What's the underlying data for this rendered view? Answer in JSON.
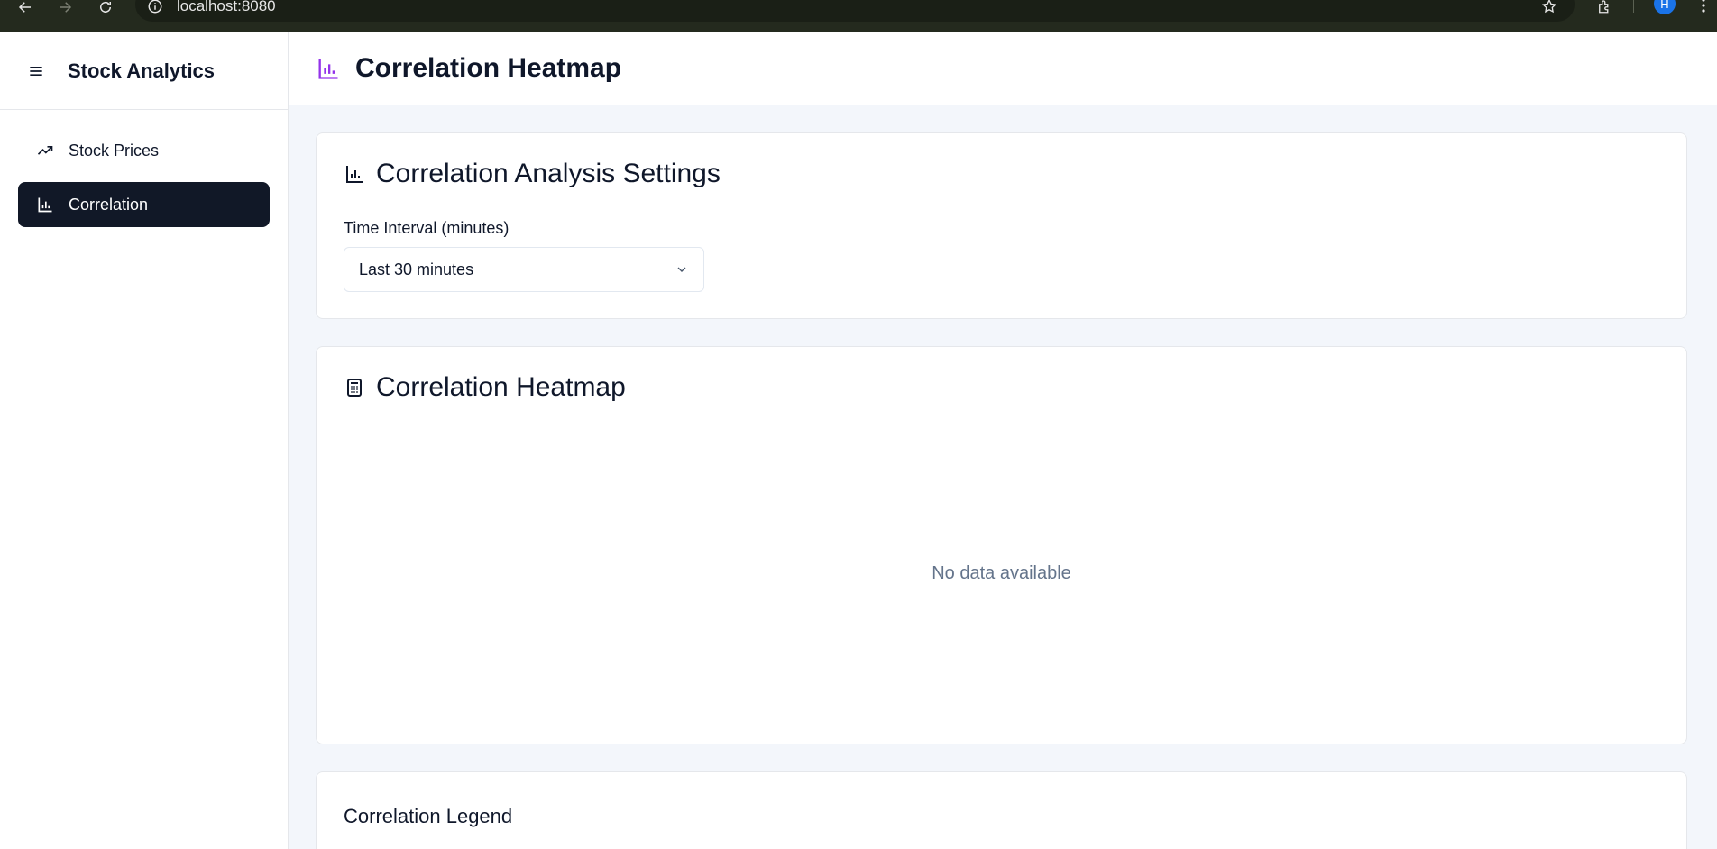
{
  "browser": {
    "url": "localhost:8080",
    "profile_initial": "H"
  },
  "sidebar": {
    "app_title": "Stock Analytics",
    "items": [
      {
        "label": "Stock Prices",
        "icon": "trending-up-icon",
        "active": false
      },
      {
        "label": "Correlation",
        "icon": "bar-chart-icon",
        "active": true
      }
    ]
  },
  "header": {
    "title": "Correlation Heatmap",
    "icon": "bar-chart-icon",
    "icon_color": "#9333ea"
  },
  "settings": {
    "title": "Correlation Analysis Settings",
    "field_label": "Time Interval (minutes)",
    "selected_interval": "Last 30 minutes"
  },
  "heatmap": {
    "title": "Correlation Heatmap",
    "empty_message": "No data available"
  },
  "legend": {
    "title": "Correlation Legend"
  },
  "colors": {
    "active_nav_bg": "#111827",
    "main_bg": "#f3f6fb",
    "accent": "#9333ea"
  }
}
